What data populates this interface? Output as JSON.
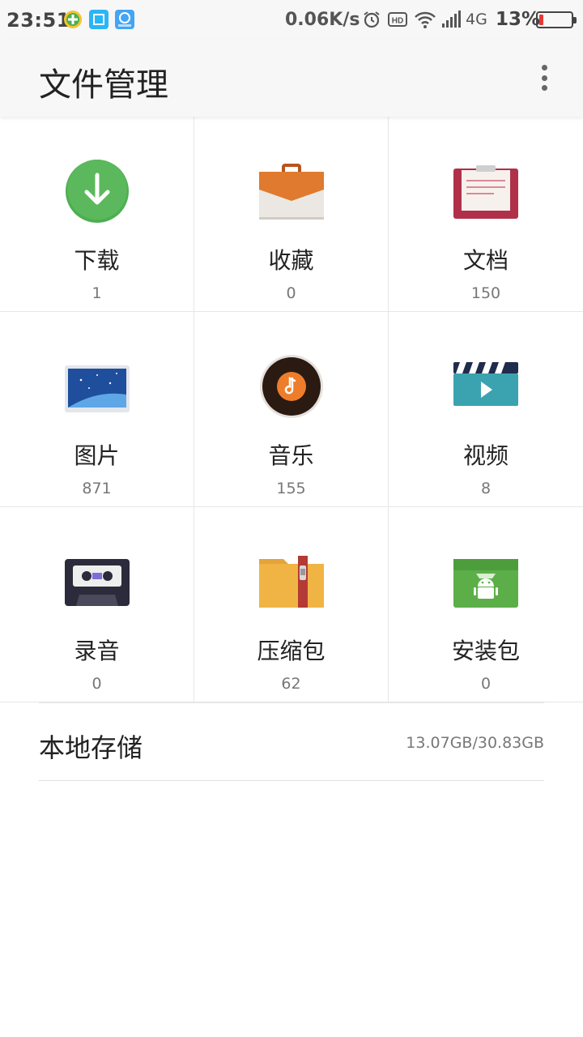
{
  "status_bar": {
    "time": "23:51",
    "net_speed": "0.06K/s",
    "hd_badge": "HD",
    "network_type": "4G",
    "battery_percent": "13%",
    "battery_level": 0.13,
    "battery_color": "#e53935"
  },
  "header": {
    "title": "文件管理",
    "menu_icon": "more-vert-icon"
  },
  "categories": [
    {
      "label": "下载",
      "count": "1",
      "icon": "download-icon"
    },
    {
      "label": "收藏",
      "count": "0",
      "icon": "favorites-icon"
    },
    {
      "label": "文档",
      "count": "150",
      "icon": "document-icon"
    },
    {
      "label": "图片",
      "count": "871",
      "icon": "image-icon"
    },
    {
      "label": "音乐",
      "count": "155",
      "icon": "music-icon"
    },
    {
      "label": "视频",
      "count": "8",
      "icon": "video-icon"
    },
    {
      "label": "录音",
      "count": "0",
      "icon": "recording-icon"
    },
    {
      "label": "压缩包",
      "count": "62",
      "icon": "archive-icon"
    },
    {
      "label": "安装包",
      "count": "0",
      "icon": "apk-icon"
    }
  ],
  "storage": {
    "label": "本地存储",
    "usage": "13.07GB/30.83GB"
  }
}
